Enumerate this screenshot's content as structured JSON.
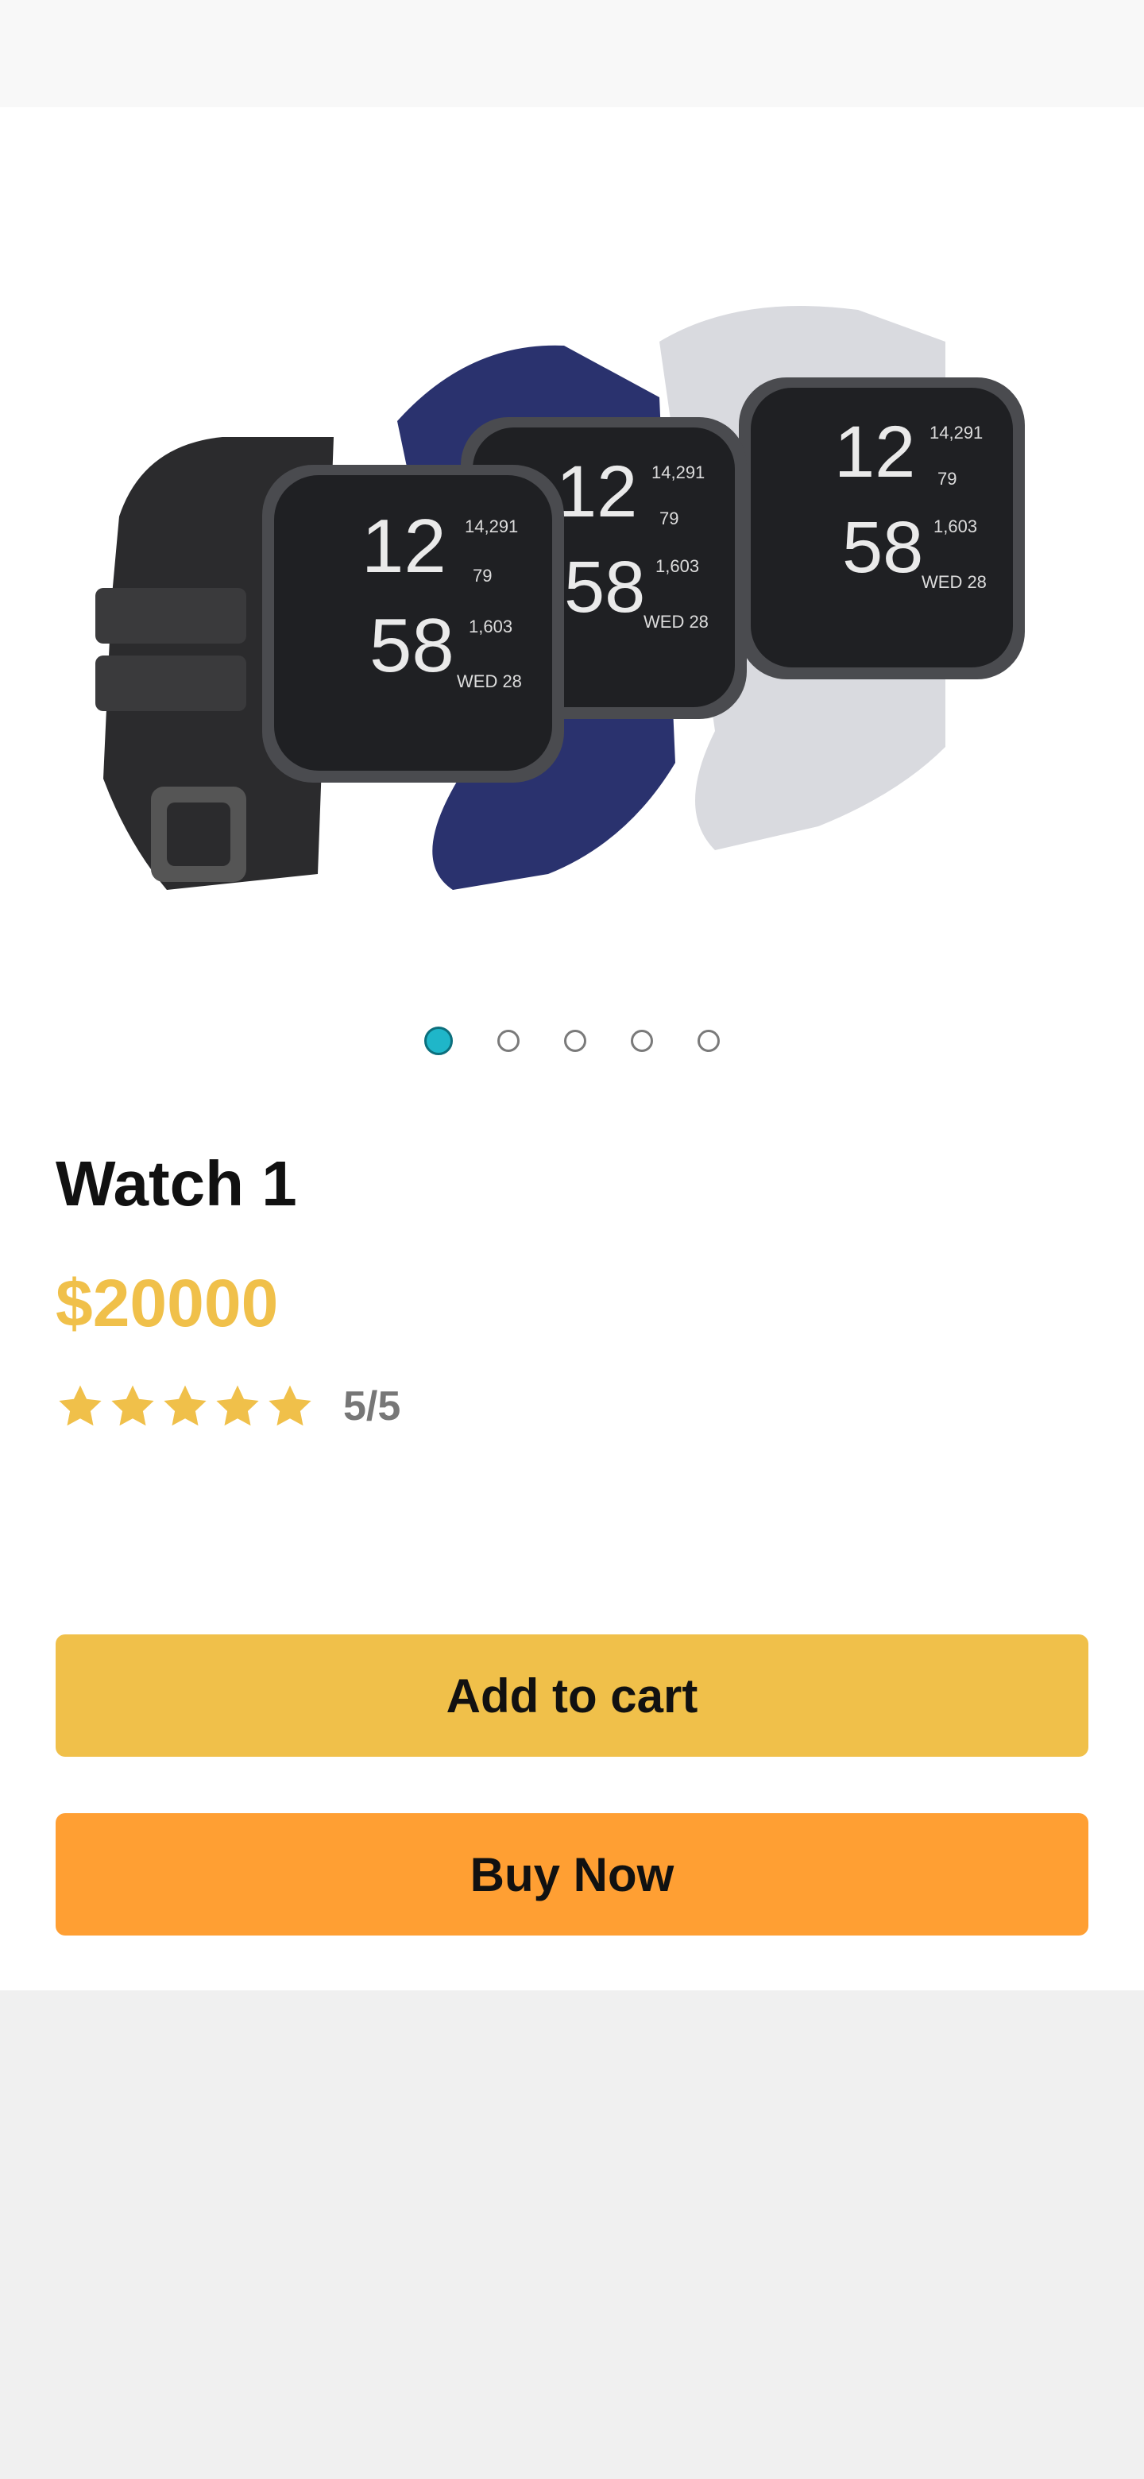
{
  "carousel": {
    "active_index": 0,
    "dots": [
      "dot-1",
      "dot-2",
      "dot-3",
      "dot-4",
      "dot-5"
    ]
  },
  "product": {
    "title": "Watch 1",
    "price": "$20000",
    "rating_value": 5,
    "rating_max": 5,
    "rating_text": "5/5"
  },
  "watch_faces": {
    "hour": "12",
    "minute": "58",
    "steps": "14,291",
    "heart": "79",
    "calories": "1,603",
    "date": "WED 28"
  },
  "actions": {
    "add_to_cart": "Add to cart",
    "buy_now": "Buy Now"
  },
  "colors": {
    "price": "#f0c04a",
    "star": "#f0c04a",
    "add_to_cart_bg": "#f0c04a",
    "buy_now_bg": "#ff9f33",
    "active_dot": "#1fb6c9"
  },
  "icons": {
    "star": "star-icon"
  }
}
